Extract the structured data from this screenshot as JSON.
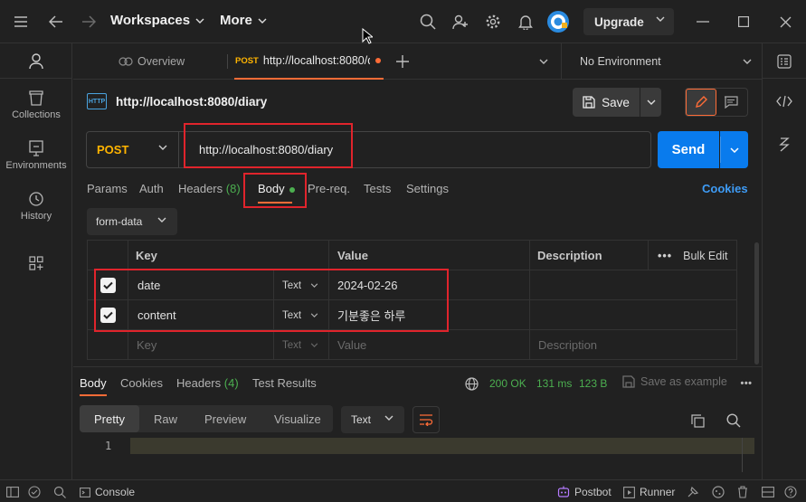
{
  "topbar": {
    "workspaces_label": "Workspaces",
    "more_label": "More",
    "upgrade_label": "Upgrade"
  },
  "sidebar": {
    "items": [
      {
        "label": "Collections"
      },
      {
        "label": "Environments"
      },
      {
        "label": "History"
      }
    ]
  },
  "tabs": {
    "overview_label": "Overview",
    "active_method": "POST",
    "active_label": "http://localhost:8080/d",
    "environment": "No Environment"
  },
  "request": {
    "name": "http://localhost:8080/diary",
    "save_label": "Save",
    "method": "POST",
    "url": "http://localhost:8080/diary",
    "send_label": "Send"
  },
  "request_tabs": {
    "params": "Params",
    "auth": "Auth",
    "headers": "Headers",
    "headers_count": "(8)",
    "body": "Body",
    "prereq": "Pre-req.",
    "tests": "Tests",
    "settings": "Settings",
    "cookies": "Cookies"
  },
  "body_mode": "form-data",
  "params_table": {
    "headers": {
      "key": "Key",
      "value": "Value",
      "description": "Description",
      "bulk_edit": "Bulk Edit"
    },
    "rows": [
      {
        "key": "date",
        "type": "Text",
        "value": "2024-02-26"
      },
      {
        "key": "content",
        "type": "Text",
        "value": "기분좋은 하루"
      }
    ],
    "placeholder": {
      "key": "Key",
      "type": "Text",
      "value": "Value",
      "description": "Description"
    }
  },
  "response": {
    "tabs": {
      "body": "Body",
      "cookies": "Cookies",
      "headers": "Headers",
      "headers_count": "(4)",
      "test_results": "Test Results"
    },
    "status": "200 OK",
    "time": "131 ms",
    "size": "123 B",
    "save_example": "Save as example",
    "views": [
      "Pretty",
      "Raw",
      "Preview",
      "Visualize"
    ],
    "format": "Text",
    "line_number": "1"
  },
  "statusbar": {
    "console": "Console",
    "postbot": "Postbot",
    "runner": "Runner"
  },
  "colors": {
    "accent": "#ff6c37",
    "send": "#097bed",
    "method_post": "#ffb400",
    "success": "#4caf50",
    "highlight": "#e0242c"
  }
}
